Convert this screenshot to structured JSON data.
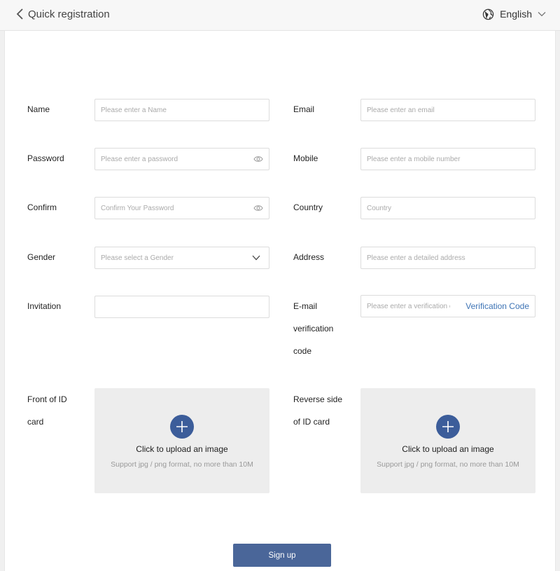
{
  "header": {
    "title": "Quick registration",
    "language": "English"
  },
  "form": {
    "name": {
      "label": "Name",
      "placeholder": "Please enter a Name"
    },
    "email": {
      "label": "Email",
      "placeholder": "Please enter an email"
    },
    "password": {
      "label": "Password",
      "placeholder": "Please enter a password"
    },
    "mobile": {
      "label": "Mobile",
      "placeholder": "Please enter a mobile number"
    },
    "confirm": {
      "label": "Confirm",
      "placeholder": "Confirm Your Password"
    },
    "country": {
      "label": "Country",
      "placeholder": "Country"
    },
    "gender": {
      "label": "Gender",
      "placeholder": "Please select a Gender"
    },
    "address": {
      "label": "Address",
      "placeholder": "Please enter a detailed address"
    },
    "invitation": {
      "label": "Invitation",
      "placeholder": ""
    },
    "email_code": {
      "label_lines": [
        "E-mail",
        "verification",
        "code"
      ],
      "placeholder": "Please enter a verification code",
      "button": "Verification Code"
    },
    "id_front": {
      "label_lines": [
        "Front of ID",
        "card"
      ],
      "upload_title": "Click to upload an image",
      "upload_hint": "Support jpg / png format, no more than 10M"
    },
    "id_back": {
      "label_lines": [
        "Reverse side",
        "of ID card"
      ],
      "upload_title": "Click to upload an image",
      "upload_hint": "Support jpg / png format, no more than 10M"
    },
    "submit": "Sign up"
  },
  "icons": {
    "back": "chevron-left-icon",
    "language": "globe-icon",
    "language_dropdown": "chevron-down-icon",
    "password_toggle": "eye-icon",
    "select_dropdown": "chevron-down-icon",
    "upload": "plus-icon"
  },
  "colors": {
    "accent": "#3e74b5",
    "primary_button": "#4a6699",
    "upload_icon_bg": "#3c5d9a",
    "upload_bg": "#ededed"
  }
}
